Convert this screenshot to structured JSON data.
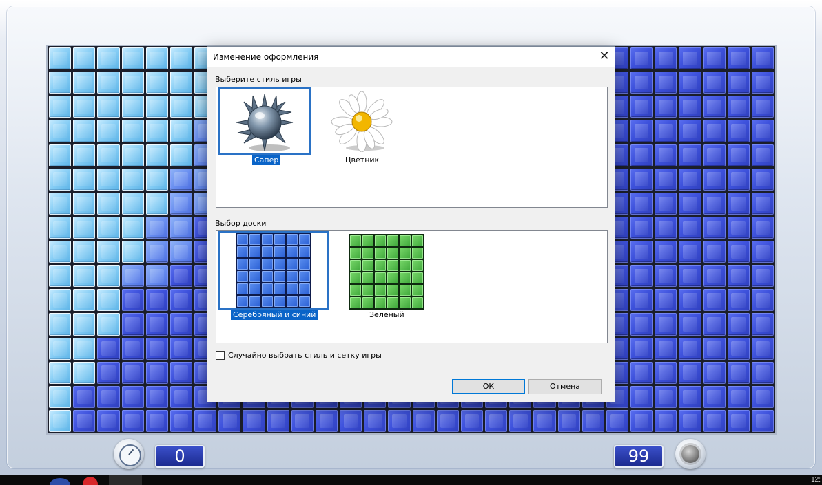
{
  "game": {
    "time_counter": "0",
    "mines_counter": "99",
    "board_columns": 30,
    "board_rows": 16
  },
  "dialog": {
    "title": "Изменение оформления",
    "close_glyph": "✕",
    "style_group_label": "Выберите стиль игры",
    "styles": [
      {
        "label": "Сапер",
        "selected": true,
        "icon": "mine-icon"
      },
      {
        "label": "Цветник",
        "selected": false,
        "icon": "daisy-icon"
      }
    ],
    "board_group_label": "Выбор доски",
    "boards": [
      {
        "label": "Серебряный и синий",
        "selected": true,
        "color": "#2a5fd4"
      },
      {
        "label": "Зеленый",
        "selected": false,
        "color": "#3ea73a"
      }
    ],
    "random_checkbox_label": "Случайно выбрать стиль и сетку игры",
    "random_checkbox_checked": false,
    "ok_label": "ОК",
    "cancel_label": "Отмена"
  },
  "colors": {
    "selection": "#0a64c8",
    "tile_blue": "#3e52dc",
    "tile_light": "#86cdf5"
  },
  "taskbar": {
    "clock_partial": "12:"
  }
}
